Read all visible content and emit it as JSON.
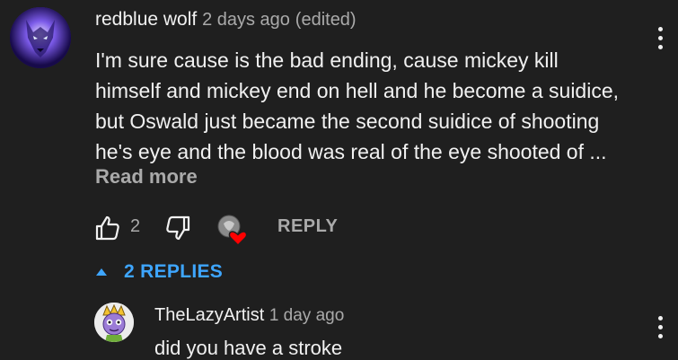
{
  "comment": {
    "author": "redblue wolf",
    "timestamp": "2 days ago",
    "edited_label": "(edited)",
    "text_lines": [
      "I'm sure cause is the bad ending, cause mickey kill",
      "himself and mickey end on hell and he become a suidice,",
      "but Oswald just became the second suidice of shooting",
      "he's eye and the blood was real of the eye shooted of ..."
    ],
    "read_more_label": "Read more",
    "like_count": "2",
    "reply_label": "REPLY",
    "avatar_icon": "wolf-avatar",
    "creator_heart_icon": "creator-heart"
  },
  "replies_toggle": {
    "label": "2 REPLIES",
    "accent_color": "#3ea6ff"
  },
  "reply": {
    "author": "TheLazyArtist",
    "timestamp": "1 day ago",
    "text": "did you have a stroke",
    "avatar_icon": "cartoon-avatar"
  },
  "colors": {
    "background": "#1f1f1f",
    "primary_text": "#f1f1f1",
    "secondary_text": "#aaaaaa",
    "heart": "#ff0000"
  }
}
